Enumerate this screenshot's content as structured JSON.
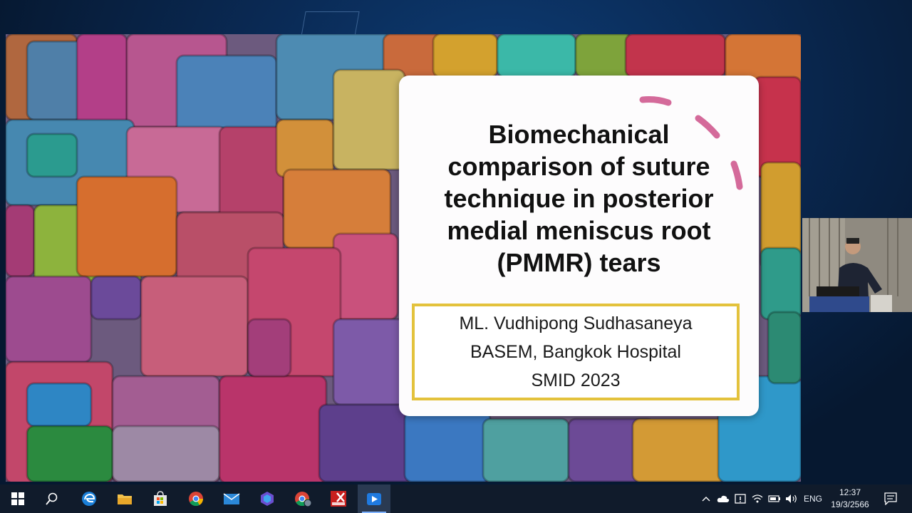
{
  "slide": {
    "title": "Biomechanical comparison of suture technique in posterior medial meniscus root (PMMR) tears",
    "author": "ML. Vudhipong Sudhasaneya",
    "affiliation": "BASEM, Bangkok Hospital",
    "event": "SMID 2023"
  },
  "taskbar": {
    "apps": [
      "windows-start",
      "search",
      "edge",
      "file-explorer",
      "microsoft-store",
      "chrome",
      "mail",
      "copilot",
      "chrome-profile",
      "pdf-x",
      "media-player"
    ],
    "active_app": "media-player",
    "tray": {
      "language": "ENG",
      "time": "12:37",
      "date": "19/3/2566"
    }
  },
  "colors": {
    "accent_frame": "#e3c23c",
    "card_bg": "#fdfcfd",
    "deco_pink": "#d46a9a",
    "taskbar_bg": "#101b2b"
  }
}
